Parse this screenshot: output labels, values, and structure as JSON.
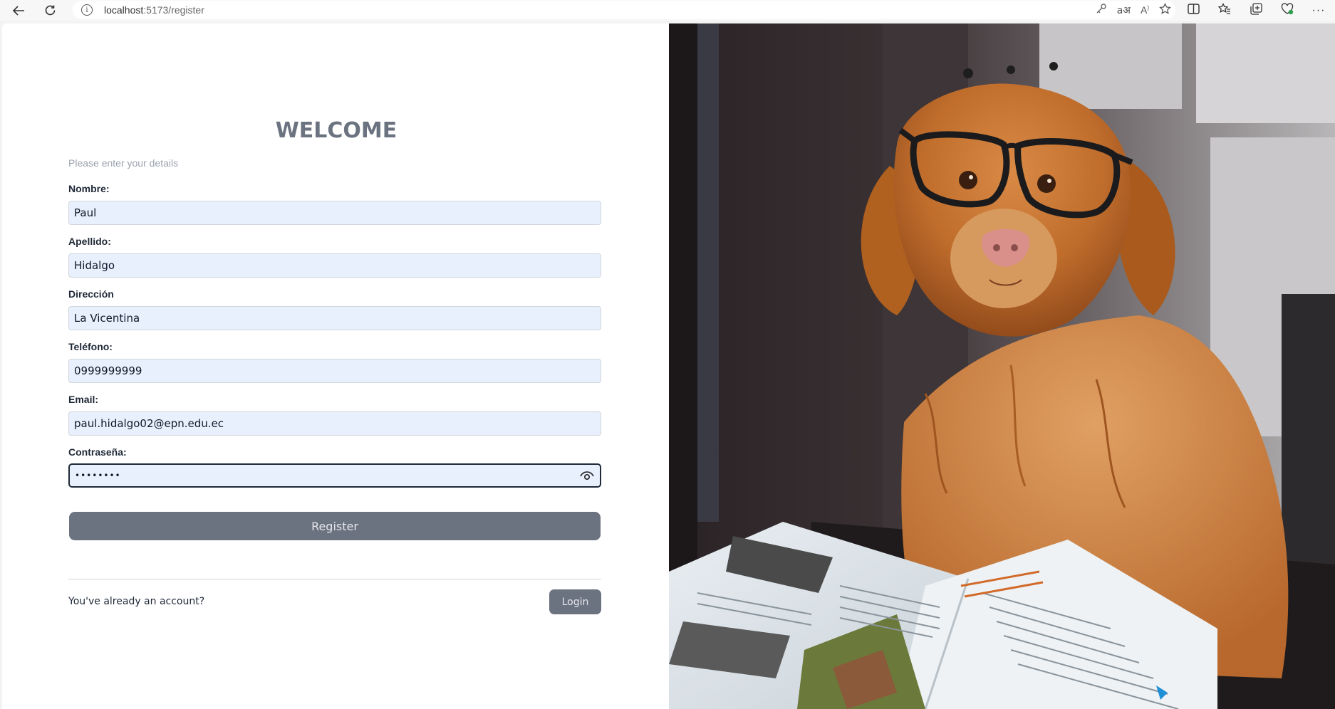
{
  "browser": {
    "url_host": "localhost",
    "url_rest": ":5173/register"
  },
  "page": {
    "title": "WELCOME",
    "subtitle": "Please enter your details",
    "fields": [
      {
        "label": "Nombre:",
        "value": "Paul"
      },
      {
        "label": "Apellido:",
        "value": "Hidalgo"
      },
      {
        "label": "Dirección",
        "value": "La Vicentina"
      },
      {
        "label": "Teléfono:",
        "value": "0999999999"
      },
      {
        "label": "Email:",
        "value": "paul.hidalgo02@epn.edu.ec"
      },
      {
        "label": "Contraseña:",
        "value": "••••••••"
      }
    ],
    "register_label": "Register",
    "account_text": "You've already an account?",
    "login_label": "Login"
  },
  "colors": {
    "button_bg": "#6b7280",
    "input_bg": "#e8f0fe",
    "title": "#6b7280"
  },
  "icons": [
    "back-icon",
    "refresh-icon",
    "info-icon",
    "key-icon",
    "translate-icon",
    "read-aloud-icon",
    "favorite-star-icon",
    "split-screen-icon",
    "favorites-icon",
    "collections-icon",
    "browser-essentials-icon",
    "more-icon",
    "eye-icon"
  ]
}
